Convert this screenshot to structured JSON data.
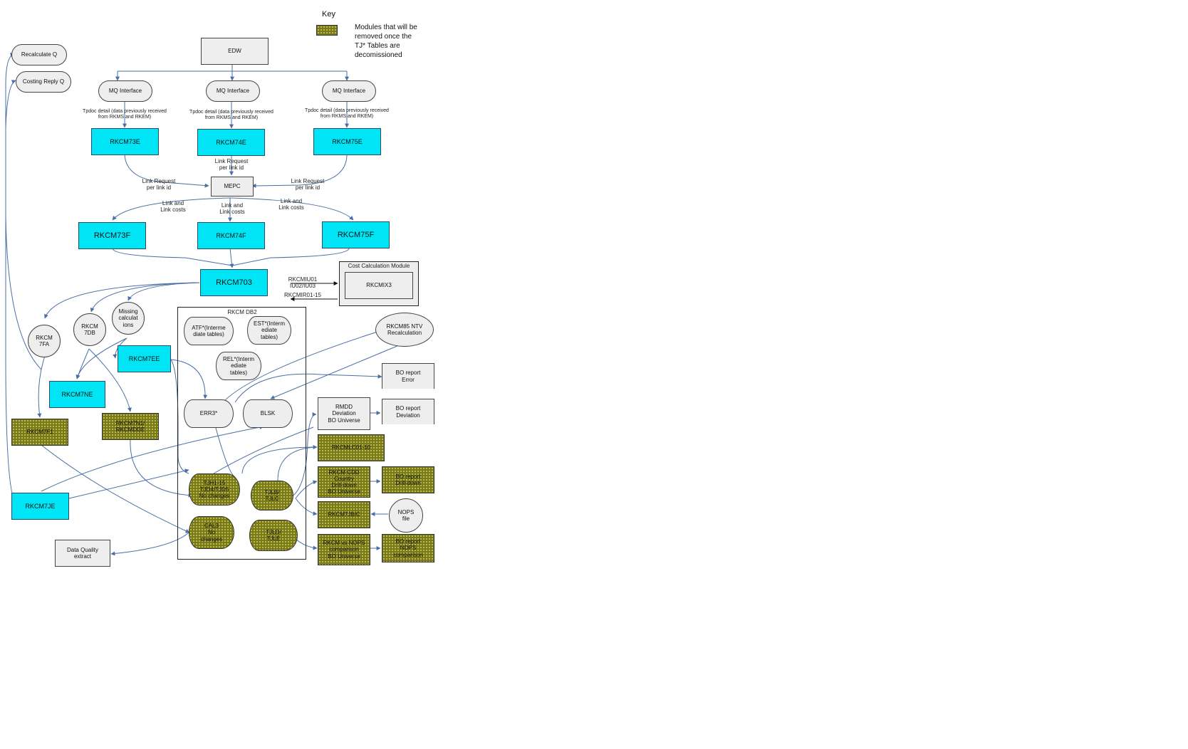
{
  "key": {
    "title": "Key",
    "text": "Modules that will be\nremoved once the\nTJ* Tables are\ndecomissioned",
    "swatch_color": "#7a7a12"
  },
  "colors": {
    "cyan": "#00e5f5",
    "olive": "#7a7a12",
    "grey": "#eeeeee",
    "arrow": "#4a6fa5"
  },
  "nodes": {
    "edw": "EDW",
    "mq1": "MQ Interface",
    "mq2": "MQ Interface",
    "mq3": "MQ Interface",
    "recalc_q": "Recalculate Q",
    "costing_q": "Costing Reply Q",
    "rkcm73e": "RKCM73E",
    "rkcm74e": "RKCM74E",
    "rkcm75e": "RKCM75E",
    "mepc": "MEPC",
    "rkcm73f": "RKCM73F",
    "rkcm74f": "RKCM74F",
    "rkcm75f": "RKCM75F",
    "rkcm703": "RKCM703",
    "cost_module_title": "Cost Calculation Module",
    "rkcmix3": "RKCMIX3",
    "rkcm7fa": "RKCM\n7FA",
    "rkcm7db": "RKCM\n7DB",
    "missing": "Missing\ncalculat\nions",
    "db2_title": "RKCM DB2",
    "atf": "ATF*(Interme\ndiate tables)",
    "est": "EST*(Interm\nediate\ntables)",
    "rel": "REL*(Interm\nediate\ntables)",
    "rkcm85": "RKCM85 NTV\nRecalculation",
    "rkcm7ee": "RKCM7EE",
    "rkcm7ne": "RKCM7NE",
    "bo_error": "BO report\nError",
    "err3": "ERR3*",
    "blsk": "BLSK",
    "rmdd": "RMDD\nDeviation\nBO Universe",
    "bo_deviation": "BO report\nDeviation",
    "rkcm7f1": "RKCM7F1",
    "rkcm7n1": "RKCM7N1/\nRKCMDDE",
    "rkcmlc": "RKCMLC01-10",
    "tjh": "TJH1-15\nTJD4/TJD5\nNo changes",
    "tjlb": "TJLB/\nTJLC",
    "rkcm_cdd": "RKCM CDD\nCountry\nDrill-down\nBO Universe",
    "bo_drill": "BO report\nDrill-down",
    "rkcm7je": "RKCM7JE",
    "rkcm7jbc": "RKCM7JB/C",
    "nops_file": "NOPS\nfile",
    "cal3": "CAL3\nNo\nchanges",
    "tjld": "TJLD/\nTJLE",
    "dq_extract": "Data Quality\nextract",
    "rkcm_nops": "RKCM vs NOPS\ncomparison\nBO Universe",
    "bo_nops": "BO report\nNOPS\ncomparison"
  },
  "labels": {
    "tpdoc1": "Tpdoc detail (data previously received\nfrom RKMS and RKEM)",
    "tpdoc2": "Tpdoc detail (data previously received\nfrom RKMS and RKEM)",
    "tpdoc3": "Tpdoc detail (data previously received\nfrom RKMS and RKEM)",
    "link_req_left": "Link Request\nper link id",
    "link_req_mid": "Link Request\nper link id",
    "link_req_right": "Link Request\nper link id",
    "link_costs_left": "Link and\nLink costs",
    "link_costs_mid": "Link and\nLink costs",
    "link_costs_right": "Link and\nLink costs",
    "iu": "RKCMIU01\nIU02/IU03",
    "ir": "RKCMIR01-15"
  }
}
